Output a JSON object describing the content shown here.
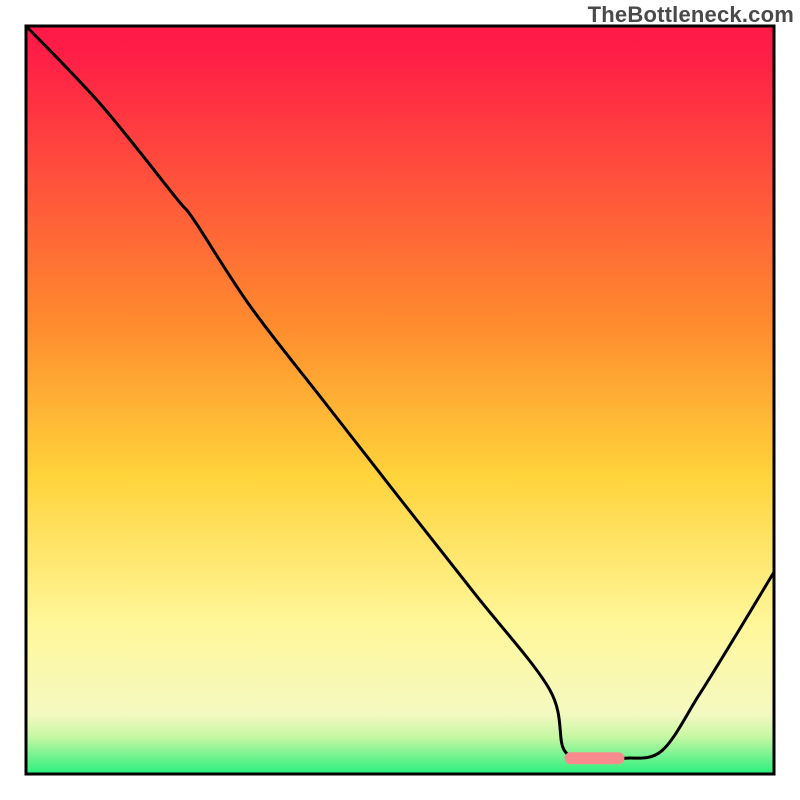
{
  "watermark": "TheBottleneck.com",
  "colors": {
    "top": "#ff1a47",
    "upper_mid": "#ff7a2e",
    "mid": "#ffd33a",
    "lower_mid": "#fff79a",
    "bottom": "#28f07d",
    "curve": "#000000",
    "marker": "#f98b8e"
  },
  "chart_data": {
    "type": "line",
    "title": "",
    "xlabel": "",
    "ylabel": "",
    "xlim": [
      0,
      100
    ],
    "ylim": [
      0,
      100
    ],
    "series": [
      {
        "name": "bottleneck-curve",
        "x": [
          0,
          10,
          20,
          22.5,
          30,
          40,
          50,
          60,
          70,
          72,
          76,
          80,
          85,
          90,
          95,
          100
        ],
        "y": [
          100,
          89.5,
          77.1,
          74,
          62.5,
          49.6,
          36.8,
          24.1,
          11.3,
          3.1,
          2.1,
          2.1,
          3.1,
          10.6,
          18.7,
          27.0
        ]
      }
    ],
    "marker": {
      "x_start": 72,
      "x_end": 80,
      "y": 2.1
    },
    "gradient_stops_vertical_pct": [
      {
        "offset": 0,
        "color": "#ff1a47"
      },
      {
        "offset": 3.1,
        "color": "#ff1c47"
      },
      {
        "offset": 40,
        "color": "#ff8c2e"
      },
      {
        "offset": 60,
        "color": "#ffd33a"
      },
      {
        "offset": 80,
        "color": "#fff79a"
      },
      {
        "offset": 92,
        "color": "#f4f9c1"
      },
      {
        "offset": 95,
        "color": "#c7f7a3"
      },
      {
        "offset": 100,
        "color": "#28f07d"
      }
    ]
  }
}
